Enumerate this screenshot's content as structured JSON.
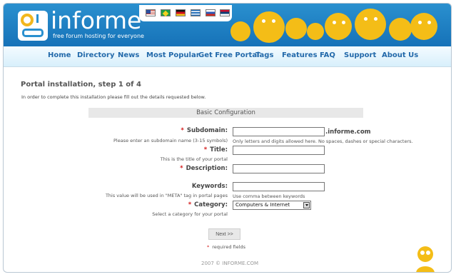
{
  "brand": {
    "name": "informe",
    "tagline": "free forum hosting for everyone"
  },
  "nav": {
    "items": [
      {
        "label": "Home"
      },
      {
        "label": "Directory"
      },
      {
        "label": "News"
      },
      {
        "label": "Most Popular"
      },
      {
        "label": "Get Free Portal"
      },
      {
        "label": "Tags"
      },
      {
        "label": "Features"
      },
      {
        "label": "FAQ"
      },
      {
        "label": "Support"
      },
      {
        "label": "About Us"
      }
    ]
  },
  "page": {
    "title": "Portal installation, step 1 of 4",
    "intro": "In order to complete this installation please fill out the details requested below.",
    "section_title": "Basic Configuration"
  },
  "form": {
    "subdomain": {
      "label": "Subdomain:",
      "help": "Please enter an subdomain name (3-15 symbols)",
      "value": "",
      "suffix": ".informe.com",
      "hint": "Only letters and digits allowed here. No spaces, dashes or special characters."
    },
    "title": {
      "label": "Title:",
      "help": "This is the title of your portal",
      "value": ""
    },
    "description": {
      "label": "Description:",
      "value": ""
    },
    "keywords": {
      "label": "Keywords:",
      "help": "This value will be used in \"META\" tag in portal pages",
      "value": "",
      "hint": "Use comma between keywords"
    },
    "category": {
      "label": "Category:",
      "help": "Select a category for your portal",
      "value": "Computers & Internet"
    },
    "next_label": "Next >>",
    "required_note": "required fields",
    "required_mark": "*"
  },
  "footer": {
    "copyright": "2007 © INFORME.COM"
  },
  "colors": {
    "header_blue": "#1672b8",
    "accent_yellow": "#f4bd17",
    "nav_text": "#2269aa",
    "required_red": "#d41a1a"
  }
}
